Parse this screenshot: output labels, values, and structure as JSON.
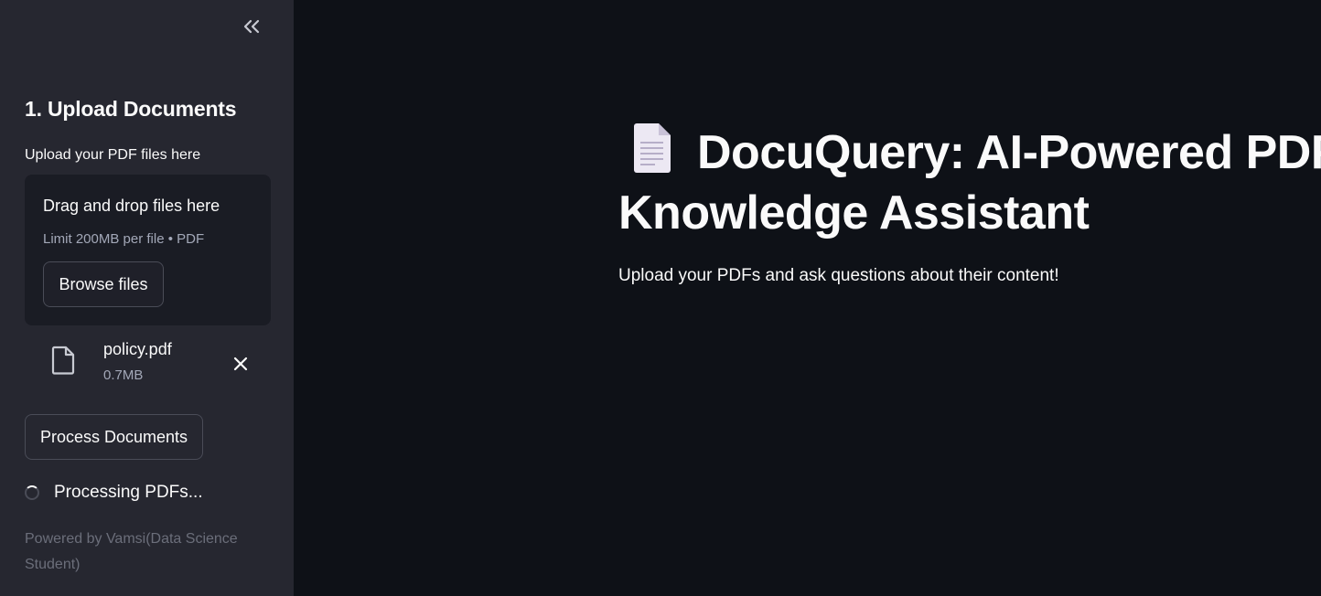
{
  "sidebar": {
    "collapse_icon": "double-chevron-left-icon",
    "section_title": "1. Upload Documents",
    "upload_label": "Upload your PDF files here",
    "dropzone": {
      "title": "Drag and drop files here",
      "limit": "Limit 200MB per file • PDF",
      "browse_label": "Browse files"
    },
    "uploaded_file": {
      "icon": "file-icon",
      "name": "policy.pdf",
      "size": "0.7MB",
      "remove_icon": "close-icon"
    },
    "process_label": "Process Documents",
    "status_text": "Processing PDFs...",
    "footer": "Powered by Vamsi(Data Science Student)"
  },
  "main": {
    "title_icon": "document-emoji-icon",
    "title": "DocuQuery: AI-Powered PDF Knowledge Assistant",
    "subtitle": "Upload your PDFs and ask questions about their content!"
  },
  "colors": {
    "main_bg": "#0e1117",
    "sidebar_bg": "#262730",
    "dropzone_bg": "#1a1c24",
    "text": "#fafafa",
    "muted_text": "#a3a8b8"
  }
}
